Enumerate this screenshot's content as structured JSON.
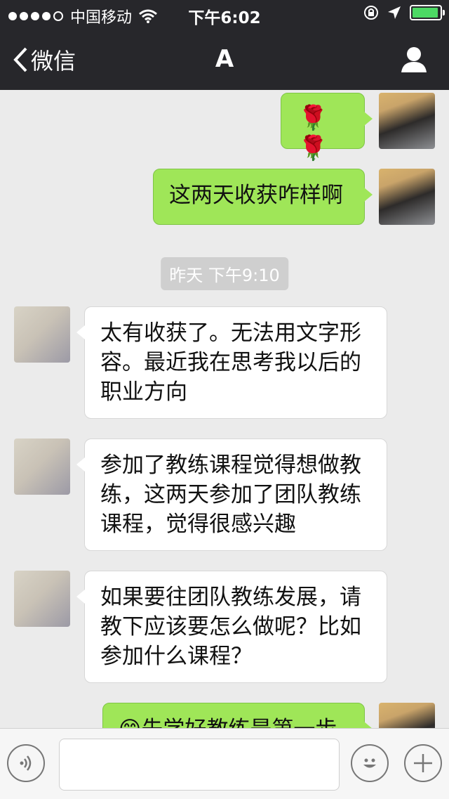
{
  "status": {
    "carrier": "中国移动",
    "time": "下午6:02"
  },
  "nav": {
    "back_label": "微信",
    "title": "A"
  },
  "messages": [
    {
      "side": "me",
      "type": "emoji",
      "text": "🌹 🌹"
    },
    {
      "side": "me",
      "type": "text",
      "text": "这两天收获咋样啊"
    },
    {
      "type": "timestamp",
      "text": "昨天 下午9:10"
    },
    {
      "side": "them",
      "type": "text",
      "lines": [
        "太有收获了。无法用文字形",
        "容。最近我在思考我以后的",
        "职业方向"
      ]
    },
    {
      "side": "them",
      "type": "text",
      "lines": [
        "参加了教练课程觉得想做教",
        "练，这两天参加了团队教练",
        "课程，觉得很感兴趣"
      ]
    },
    {
      "side": "them",
      "type": "text",
      "lines": [
        "如果要往团队教练发展，请",
        "教下应该要怎么做呢？比如",
        "参加什么课程？"
      ]
    },
    {
      "side": "me",
      "type": "text",
      "text": "😊先学好教练是第一步"
    }
  ],
  "input": {
    "placeholder": ""
  },
  "colors": {
    "topbar": "#27272b",
    "my_bubble": "#9fe658",
    "their_bubble": "#ffffff",
    "background": "#ebebeb"
  }
}
